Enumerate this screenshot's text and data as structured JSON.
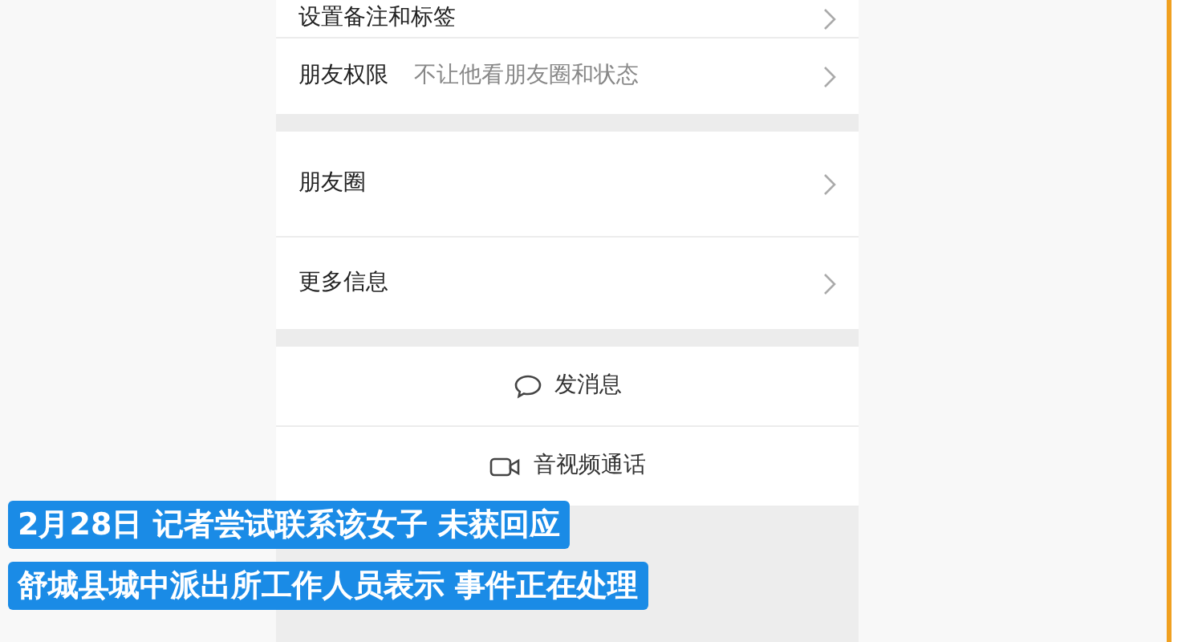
{
  "settings": [
    {
      "label": "设置备注和标签"
    },
    {
      "label": "朋友权限",
      "value": "不让他看朋友圈和状态"
    }
  ],
  "sections": [
    {
      "label": "朋友圈"
    },
    {
      "label": "更多信息"
    }
  ],
  "actions": [
    {
      "kind": "message",
      "label": "发消息"
    },
    {
      "kind": "video",
      "label": "音视频通话"
    }
  ],
  "captions": [
    "2月28日  记者尝试联系该女子  未获回应",
    "舒城县城中派出所工作人员表示 事件正在处理"
  ]
}
